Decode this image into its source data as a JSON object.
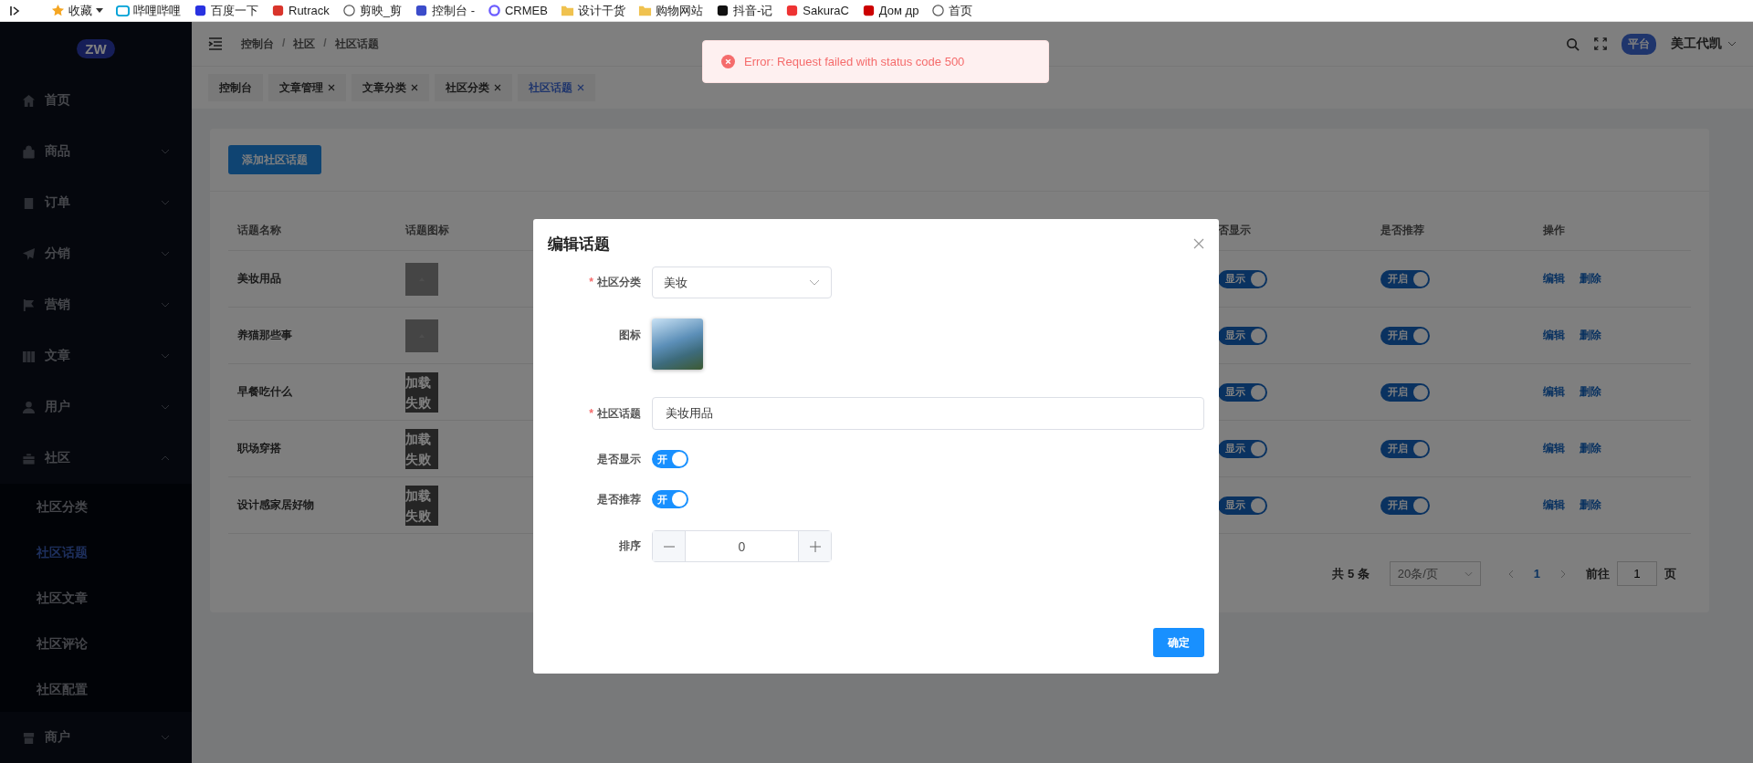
{
  "bookmarks": [
    "收藏",
    "哔哩哔哩",
    "百度一下",
    "Rutrack",
    "剪映_剪",
    "控制台 -",
    "CRMEB",
    "设计干货",
    "购物网站",
    "抖音-记",
    "SakuraC",
    "Дом др",
    "首页"
  ],
  "sidebar": {
    "logo_text": "ZW",
    "items": [
      {
        "label": "首页"
      },
      {
        "label": "商品",
        "expanded": false
      },
      {
        "label": "订单",
        "expanded": false
      },
      {
        "label": "分销",
        "expanded": false
      },
      {
        "label": "营销",
        "expanded": false
      },
      {
        "label": "文章",
        "expanded": false
      },
      {
        "label": "用户",
        "expanded": false
      },
      {
        "label": "社区",
        "expanded": true,
        "children": [
          {
            "label": "社区分类",
            "selected": false
          },
          {
            "label": "社区话题",
            "selected": true
          },
          {
            "label": "社区文章",
            "selected": false
          },
          {
            "label": "社区评论",
            "selected": false
          },
          {
            "label": "社区配置",
            "selected": false
          }
        ]
      },
      {
        "label": "商户",
        "expanded": false
      }
    ]
  },
  "header": {
    "breadcrumb": [
      "控制台",
      "社区",
      "社区话题"
    ],
    "breadcrumb_separator": "/",
    "badge": "平台",
    "user": "美工代凯"
  },
  "tabs": [
    {
      "label": "控制台",
      "closable": false,
      "selected": false
    },
    {
      "label": "文章管理",
      "closable": true,
      "selected": false
    },
    {
      "label": "文章分类",
      "closable": true,
      "selected": false
    },
    {
      "label": "社区分类",
      "closable": true,
      "selected": false
    },
    {
      "label": "社区话题",
      "closable": true,
      "selected": true
    }
  ],
  "add_button": "添加社区话题",
  "table": {
    "columns": [
      "话题名称",
      "话题图标",
      "否显示",
      "是否推荐",
      "操作"
    ],
    "rows": [
      {
        "name": "美妆用品",
        "icon": {
          "kind": "broken"
        },
        "show": {
          "label": "显示",
          "on": true
        },
        "recommend": {
          "label": "开启",
          "on": true
        },
        "actions": [
          "编辑",
          "删除"
        ]
      },
      {
        "name": "养猫那些事",
        "icon": {
          "kind": "broken"
        },
        "show": {
          "label": "显示",
          "on": true
        },
        "recommend": {
          "label": "开启",
          "on": true
        },
        "actions": [
          "编辑",
          "删除"
        ]
      },
      {
        "name": "早餐吃什么",
        "icon": {
          "kind": "failed",
          "text": "加载失败"
        },
        "show": {
          "label": "显示",
          "on": true
        },
        "recommend": {
          "label": "开启",
          "on": true
        },
        "actions": [
          "编辑",
          "删除"
        ]
      },
      {
        "name": "职场穿搭",
        "icon": {
          "kind": "failed",
          "text": "加载失败"
        },
        "show": {
          "label": "显示",
          "on": true
        },
        "recommend": {
          "label": "开启",
          "on": true
        },
        "actions": [
          "编辑",
          "删除"
        ]
      },
      {
        "name": "设计感家居好物",
        "icon": {
          "kind": "failed",
          "text": "加载失败"
        },
        "show": {
          "label": "显示",
          "on": true
        },
        "recommend": {
          "label": "开启",
          "on": true
        },
        "actions": [
          "编辑",
          "删除"
        ]
      }
    ]
  },
  "pagination": {
    "total": "共 5 条",
    "page_size": "20条/页",
    "pages": [
      {
        "label": "1",
        "selected": true
      }
    ],
    "goto_label": "前往",
    "goto_value": "1",
    "goto_suffix": "页"
  },
  "dialog": {
    "title": "编辑话题",
    "required_mark": "*",
    "fields": [
      {
        "kind": "select",
        "label": "社区分类",
        "required": true,
        "value": "美妆"
      },
      {
        "kind": "image",
        "label": "图标",
        "required": false
      },
      {
        "kind": "text",
        "label": "社区话题",
        "required": true,
        "value": "美妆用品"
      },
      {
        "kind": "switch",
        "label": "是否显示",
        "required": false,
        "on": true,
        "switch_label": "开"
      },
      {
        "kind": "switch",
        "label": "是否推荐",
        "required": false,
        "on": true,
        "switch_label": "开"
      },
      {
        "kind": "number",
        "label": "排序",
        "required": false,
        "value": "0"
      }
    ],
    "confirm": "确定"
  },
  "toast": {
    "kind": "error",
    "message": "Error: Request failed with status code 500"
  }
}
